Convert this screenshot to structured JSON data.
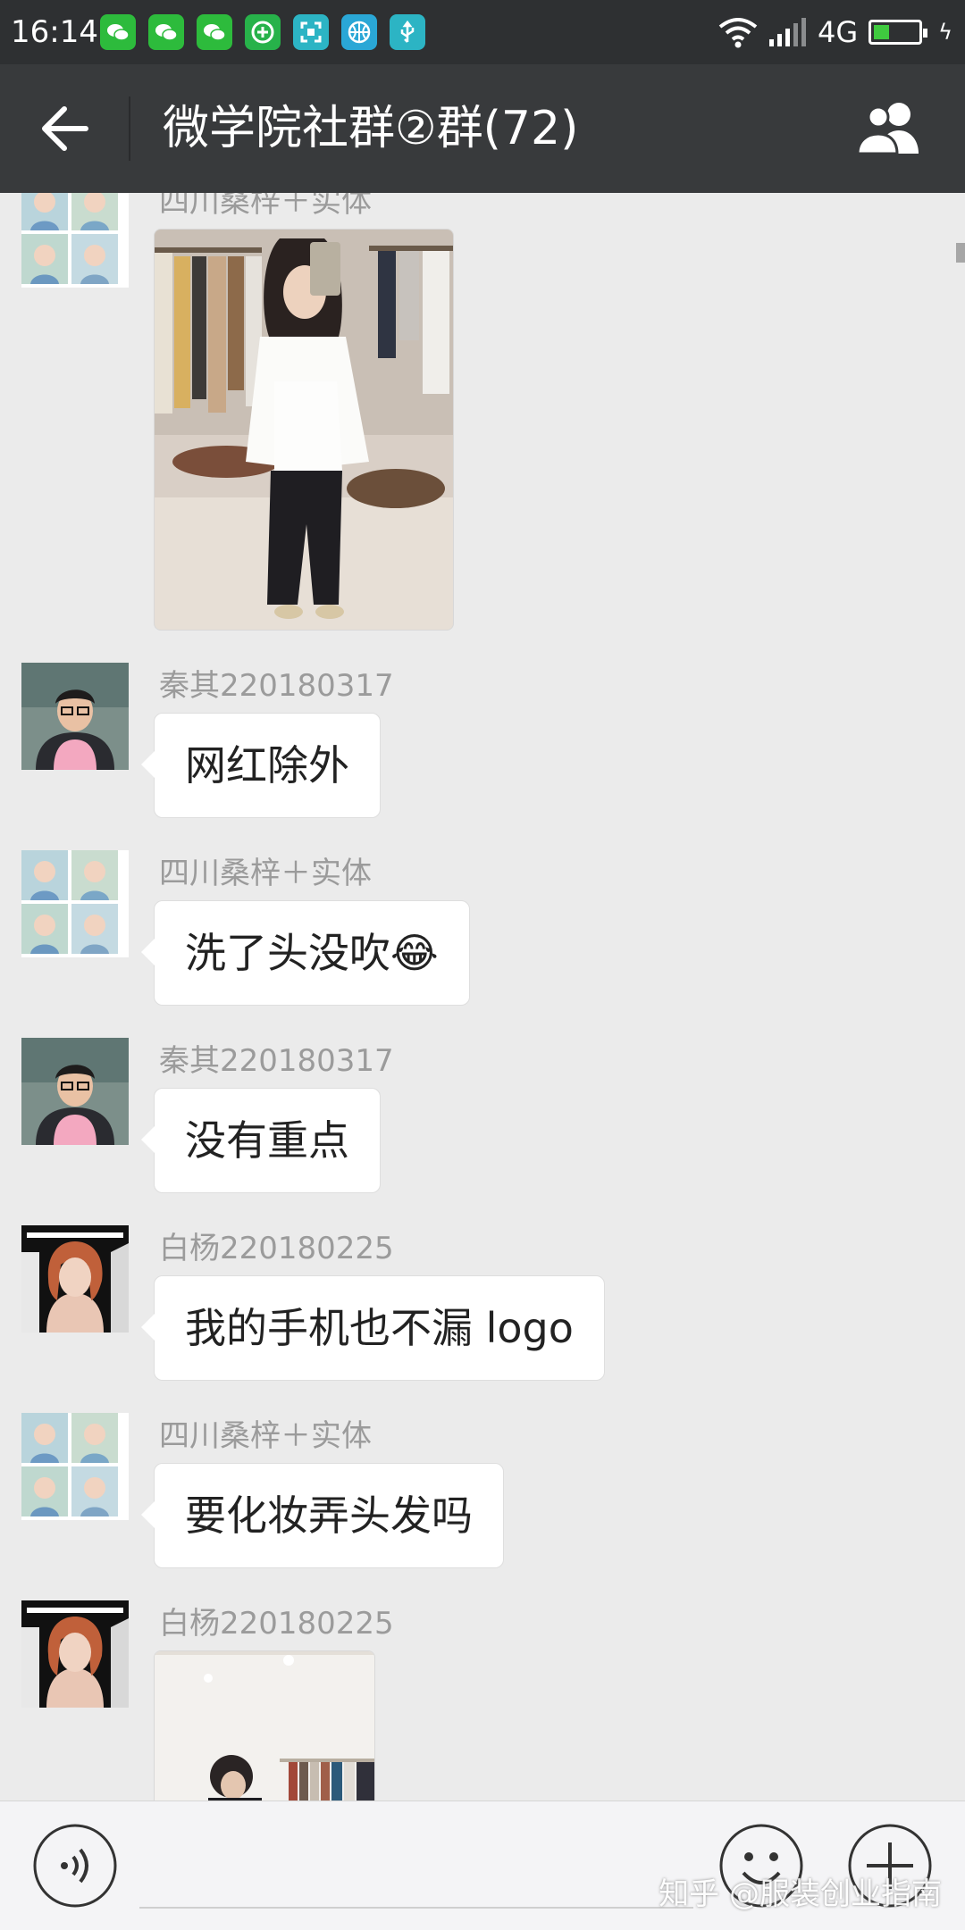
{
  "status_bar": {
    "time": "16:14",
    "network": "4G"
  },
  "header": {
    "title": "微学院社群②群(72)"
  },
  "messages": [
    {
      "sender": "四川桑梓＋实体",
      "type": "image"
    },
    {
      "sender": "秦其220180317",
      "text": "网红除外"
    },
    {
      "sender": "四川桑梓＋实体",
      "text": "洗了头没吹😂"
    },
    {
      "sender": "秦其220180317",
      "text": "没有重点"
    },
    {
      "sender": "白杨220180225",
      "text": "我的手机也不漏 logo"
    },
    {
      "sender": "四川桑梓＋实体",
      "text": "要化妆弄头发吗"
    },
    {
      "sender": "白杨220180225",
      "type": "image"
    }
  ],
  "watermark": "知乎 @服装创业指南",
  "colors": {
    "status_bar": "#2e3032",
    "title_bar": "#383a3c",
    "chat_bg": "#ebebeb",
    "bubble": "#ffffff",
    "sender_text": "#9b9b9b"
  },
  "icons": [
    "wechat-icon",
    "wechat-icon",
    "wechat-icon",
    "add-circle-icon",
    "scan-icon",
    "basketball-icon",
    "usb-icon",
    "wifi-icon",
    "signal-icon",
    "battery-icon",
    "back-arrow-icon",
    "group-members-icon",
    "voice-icon",
    "emoji-icon",
    "plus-icon"
  ]
}
